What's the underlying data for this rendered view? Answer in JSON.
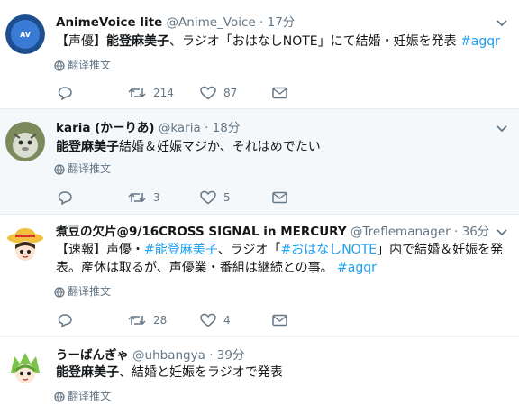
{
  "translate_label": "翻译推文",
  "tweets": [
    {
      "name": "AnimeVoice lite",
      "handle": "@Anime_Voice",
      "time": "17分",
      "text_parts": [
        "【声優】",
        "能登麻美子",
        "、ラジオ「おはなしNOTE」にて結婚・妊娠を発表 ",
        "#agqr"
      ],
      "replies": "",
      "retweets": "214",
      "likes": "87",
      "avatar_icon": "animevoice-logo-avatar",
      "colors": {
        "avatar_bg": "#1d4e8f"
      }
    },
    {
      "name": "karia (かーりあ)",
      "handle": "@karia",
      "time": "18分",
      "text_parts": [
        "能登麻美子",
        "結婚＆妊娠マジか、それはめでたい"
      ],
      "replies": "",
      "retweets": "3",
      "likes": "5",
      "avatar_icon": "creature-avatar"
    },
    {
      "name": "煮豆の欠片@9/16CROSS SIGNAL in MERCURY",
      "handle": "@Treflemanager",
      "time": "36分",
      "text_line1": [
        "【速報】声優・",
        "#能登麻美子",
        "、ラジオ「",
        "#おはなしNOTE",
        "」内で結婚＆妊娠を発"
      ],
      "text_line2": [
        "表。産休は取るが、声優業・番組は継続との事。 ",
        "#agqr"
      ],
      "replies": "",
      "retweets": "28",
      "likes": "4",
      "avatar_icon": "anime-girl-hat-avatar"
    },
    {
      "name": "うーばんぎゃ",
      "handle": "@uhbangya",
      "time": "39分",
      "text_parts": [
        "能登麻美子",
        "、結婚と妊娠をラジオで発表"
      ],
      "avatar_icon": "green-hair-girl-avatar"
    }
  ],
  "sep": "·",
  "colors": {
    "link": "#1da1f2",
    "muted": "#657786",
    "highlight_bg": "#f5f8fa"
  }
}
